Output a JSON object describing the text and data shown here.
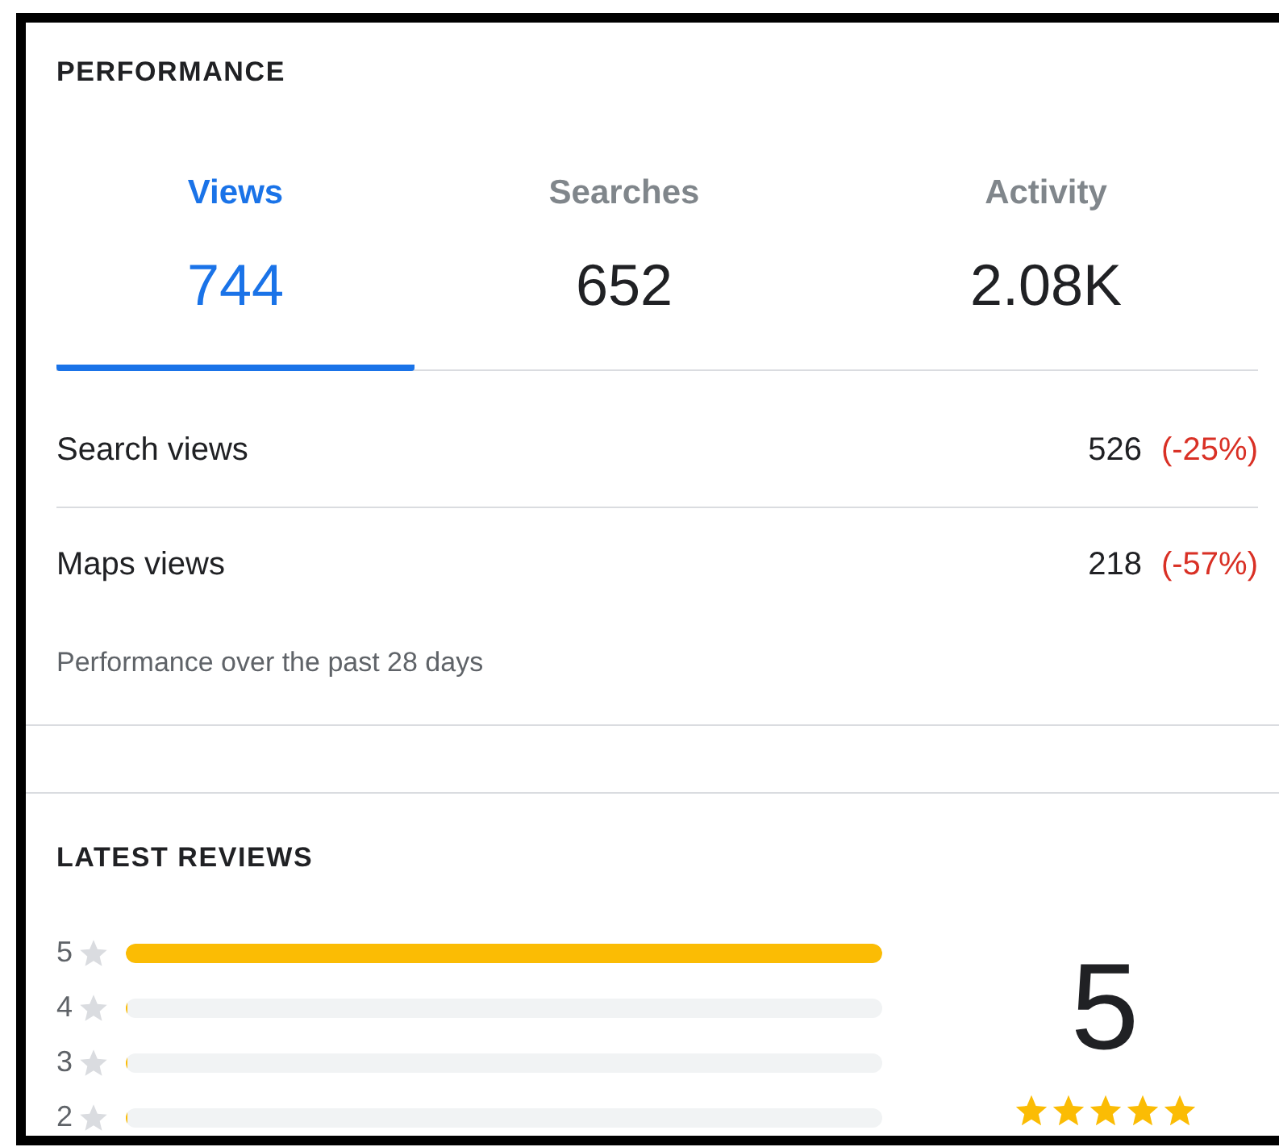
{
  "performance": {
    "title": "PERFORMANCE",
    "tabs": [
      {
        "label": "Views",
        "value": "744",
        "selected": true
      },
      {
        "label": "Searches",
        "value": "652",
        "selected": false
      },
      {
        "label": "Activity",
        "value": "2.08K",
        "selected": false
      }
    ],
    "rows": [
      {
        "label": "Search views",
        "value": "526",
        "change": "(-25%)"
      },
      {
        "label": "Maps views",
        "value": "218",
        "change": "(-57%)"
      }
    ],
    "footnote": "Performance over the past 28 days"
  },
  "reviews": {
    "title": "LATEST REVIEWS",
    "distribution": [
      {
        "label": "5",
        "level": 1
      },
      {
        "label": "4",
        "level": 0
      },
      {
        "label": "3",
        "level": 0
      },
      {
        "label": "2",
        "level": 0
      }
    ],
    "average": "5",
    "stars": 5
  }
}
